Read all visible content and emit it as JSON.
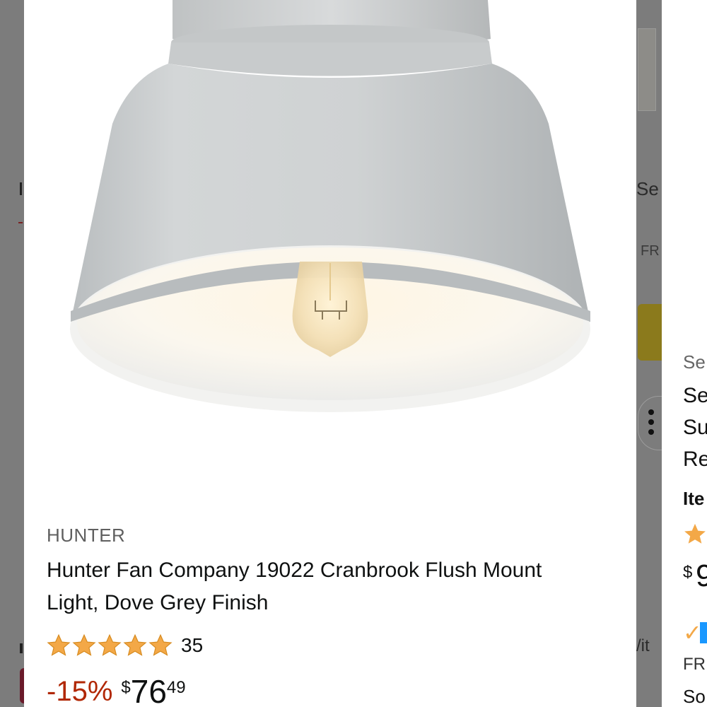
{
  "product": {
    "brand": "HUNTER",
    "title": "Hunter Fan Company 19022 Cranbrook Flush Mount Light, Dove Grey Finish",
    "rating": 5,
    "rating_count": "35",
    "discount": "-15%",
    "price_symbol": "$",
    "price_whole": "76",
    "price_fraction": "49"
  },
  "background_card": {
    "label_se": "Se",
    "label_fr": "FR",
    "label_vit": "/it"
  },
  "next_card": {
    "line1": "Se",
    "line2": "Se",
    "line3": "Su",
    "line4": "Re",
    "line5": "Ite",
    "price_symbol": "$",
    "price_partial": "9",
    "check": "✓",
    "line_fr": "FR",
    "line_so": "So"
  },
  "colors": {
    "discount": "#b12704",
    "star": "#f3a847",
    "prime_check": "#f3a847",
    "prime_blue": "#1a98ff"
  },
  "icons": [
    "ceiling-light-image",
    "star-icon",
    "more-options-icon",
    "prime-check-icon"
  ]
}
